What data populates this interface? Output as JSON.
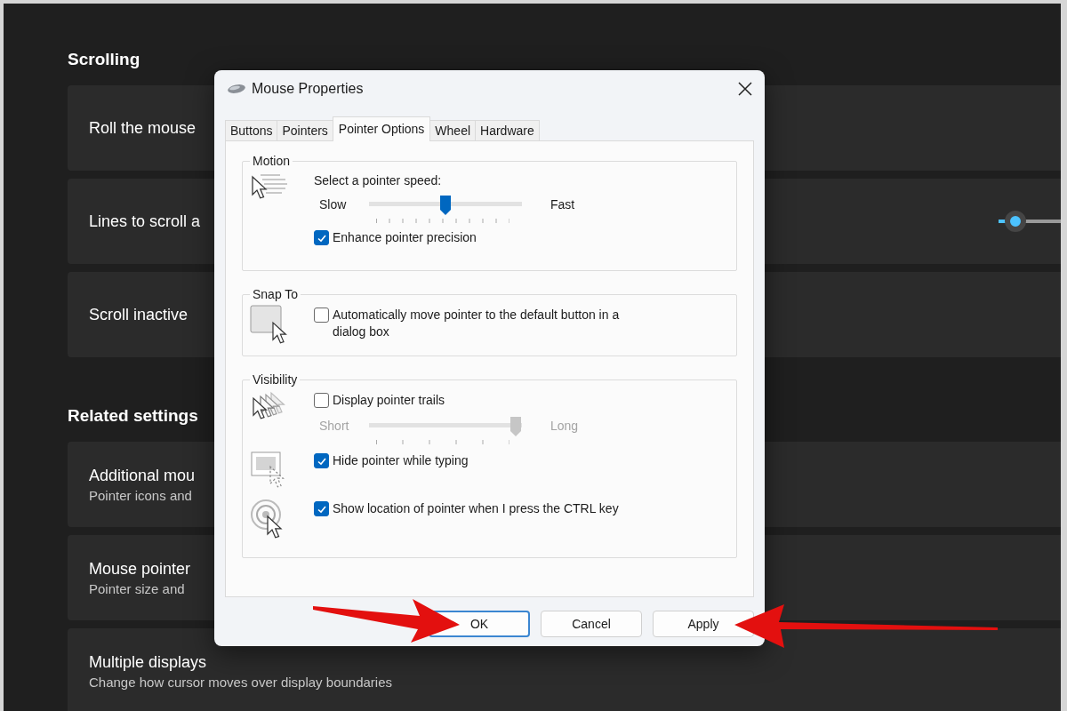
{
  "settings_page": {
    "sections": [
      {
        "title": "Scrolling",
        "cards": [
          {
            "title": "Roll the mouse"
          },
          {
            "title": "Lines to scroll a",
            "slider": {
              "level": 0.07
            }
          },
          {
            "title": "Scroll inactive"
          }
        ]
      },
      {
        "title": "Related settings",
        "cards": [
          {
            "title": "Additional mou",
            "subtitle": "Pointer icons and"
          },
          {
            "title": "Mouse pointer",
            "subtitle": "Pointer size and"
          },
          {
            "title": "Multiple displays",
            "subtitle": "Change how cursor moves over display boundaries"
          }
        ]
      }
    ]
  },
  "dialog": {
    "title": "Mouse Properties",
    "tabs": [
      {
        "label": "Buttons",
        "selected": false
      },
      {
        "label": "Pointers",
        "selected": false
      },
      {
        "label": "Pointer Options",
        "selected": true
      },
      {
        "label": "Wheel",
        "selected": false
      },
      {
        "label": "Hardware",
        "selected": false
      }
    ],
    "groups": [
      {
        "title": "Motion",
        "blocks": [
          {
            "rows": [
              {
                "kind": "label",
                "text": "Select a pointer speed:"
              },
              {
                "kind": "slider",
                "min_label": "Slow",
                "max_label": "Fast",
                "level": 0.5,
                "disabled": false
              },
              {
                "kind": "checkbox",
                "label": "Enhance pointer precision",
                "checked": true
              }
            ]
          }
        ]
      },
      {
        "title": "Snap To",
        "blocks": [
          {
            "rows": [
              {
                "kind": "checkbox",
                "label": "Automatically move pointer to the default button in a dialog box",
                "checked": false
              }
            ]
          }
        ]
      },
      {
        "title": "Visibility",
        "blocks": [
          {
            "rows": [
              {
                "kind": "checkbox",
                "label": "Display pointer trails",
                "checked": false
              },
              {
                "kind": "slider",
                "min_label": "Short",
                "max_label": "Long",
                "level": 1,
                "disabled": true
              }
            ]
          },
          {
            "rows": [
              {
                "kind": "checkbox",
                "label": "Hide pointer while typing",
                "checked": true
              }
            ]
          },
          {
            "rows": [
              {
                "kind": "checkbox",
                "label": "Show location of pointer when I press the CTRL key",
                "checked": true
              }
            ]
          }
        ]
      }
    ],
    "buttons": [
      {
        "label": "OK",
        "default": true
      },
      {
        "label": "Cancel",
        "default": false
      },
      {
        "label": "Apply",
        "default": false
      }
    ]
  }
}
